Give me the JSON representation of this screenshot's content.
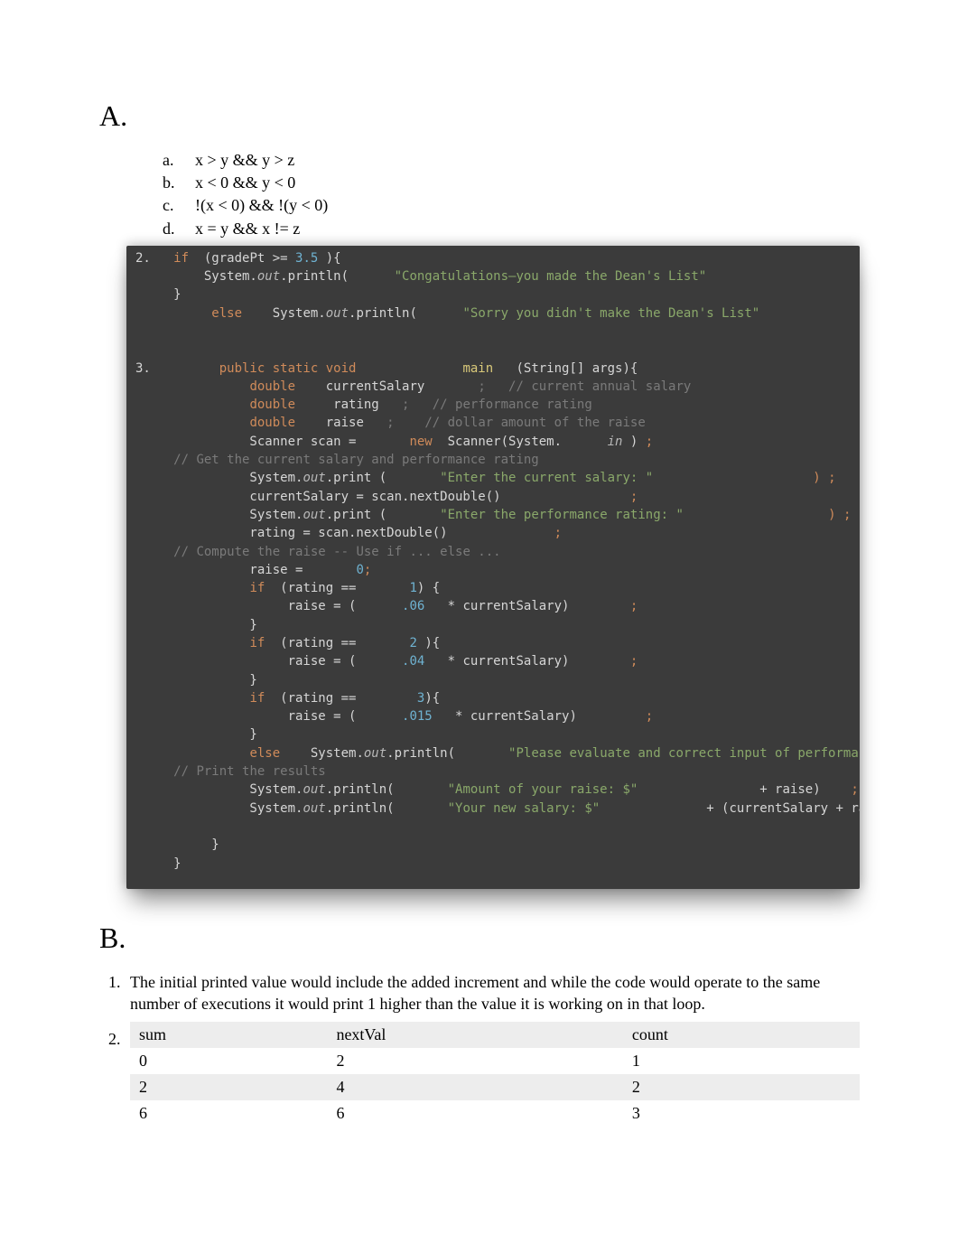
{
  "sectionA": {
    "heading": "A.",
    "exprs": {
      "a_marker": "a.",
      "a": "x > y && y > z",
      "b_marker": "b.",
      "b": "x < 0 && y < 0",
      "c_marker": "c.",
      "c": "!(x < 0) && !(y < 0)",
      "d_marker": "d.",
      "d": "x = y && x != z"
    },
    "code2": {
      "n": "2.",
      "if": "if",
      "cond_open": "  (gradePt >= ",
      "threshold": "3.5",
      "cond_close": " ){",
      "sys1a": "         System.",
      "out": "out",
      "println": ".println(",
      "str1": "\"Congatulations—you made the Dean's List\"",
      "close1": ")",
      "semi": ";",
      "brace": "     }",
      "else": "     else",
      "sys2a": "    System.",
      "str2": "\"Sorry you didn't make the Dean's List\"",
      "close2": ")"
    },
    "code3": {
      "n": "3.",
      "psv": "public static void",
      "main": "main",
      "mainargs": "   (String[] args){",
      "dbl": "double",
      "var1": "    currentSalary",
      "c1": ";   // current annual salary",
      "var2": "     rating   ",
      "c2": ";   // performance rating",
      "var3": "    raise   ",
      "c3": ";    // dollar amount of the raise",
      "scanA": "               Scanner scan = ",
      "new": "new",
      "scanB": "  Scanner(System.",
      "in": "in",
      "scanC": " )",
      "cmtGet": "// Get the current salary and performance rating",
      "sys": "               System.",
      "print": ".print (",
      "s1": "\"Enter the current salary: \"",
      "rp": ")",
      "line_cs": "               currentSalary = scan.nextDouble()",
      "s2": "\"Enter the performance rating: \"",
      "line_rt": "               rating = scan.nextDouble()",
      "cmtComp": "// Compute the raise -- Use if ... else ...",
      "raise0a": "               raise = ",
      "zero": "0",
      "if": "if",
      "ifr1a": "  (rating == ",
      "one": "1",
      "ifr1b": ") {",
      "ra": "                    raise = (",
      "p06": ".06",
      "mul": "   * currentSalary)",
      "cb": "               }",
      "two": "2",
      "ifr2b": " ){",
      "p04": ".04",
      "three": "3",
      "ifr3b": "){",
      "p015": ".015",
      "else": "else",
      "sys2": "    System.",
      "println": ".println(",
      "serr": "\"Please evaluate and correct input of performance rating\"",
      "errclose": ")",
      "cmtPrint": "// Print the results",
      "sout1": "\"Amount of your raise: $\"",
      "plus1": " + raise)",
      "sout2": "\"Your new salary: $\"",
      "plus2": " + (currentSalary + raise))"
    }
  },
  "sectionB": {
    "heading": "B.",
    "item1": "The initial printed value would include the added increment and while the code would operate to the same number of executions it would print 1 higher than the value it is working on in that loop.",
    "table": {
      "h1": "sum",
      "h2": "nextVal",
      "h3": "count",
      "rows": [
        [
          "0",
          "2",
          "1"
        ],
        [
          "2",
          "4",
          "2"
        ],
        [
          "6",
          "6",
          "3"
        ]
      ]
    }
  }
}
